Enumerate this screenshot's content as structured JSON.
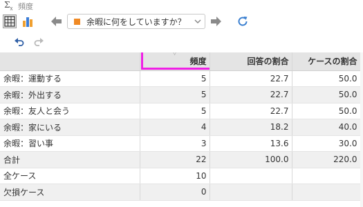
{
  "window": {
    "title": "頻度"
  },
  "toolbar": {
    "variable_select": "余暇に何をしていますか？",
    "accent_color": "#f08a24",
    "highlight_color": "#f01fe6"
  },
  "table": {
    "headers": [
      "",
      "頻度",
      "回答の割合",
      "ケースの割合"
    ],
    "rows": [
      {
        "label": "余暇：運動する",
        "freq": "5",
        "resp_pct": "22.7",
        "case_pct": "50.0"
      },
      {
        "label": "余暇：外出する",
        "freq": "5",
        "resp_pct": "22.7",
        "case_pct": "50.0"
      },
      {
        "label": "余暇：友人と会う",
        "freq": "5",
        "resp_pct": "22.7",
        "case_pct": "50.0"
      },
      {
        "label": "余暇：家にいる",
        "freq": "4",
        "resp_pct": "18.2",
        "case_pct": "40.0"
      },
      {
        "label": "余暇：習い事",
        "freq": "3",
        "resp_pct": "13.6",
        "case_pct": "30.0"
      },
      {
        "label": "合計",
        "freq": "22",
        "resp_pct": "100.0",
        "case_pct": "220.0"
      },
      {
        "label": "全ケース",
        "freq": "10",
        "resp_pct": "",
        "case_pct": ""
      },
      {
        "label": "欠損ケース",
        "freq": "0",
        "resp_pct": "",
        "case_pct": ""
      }
    ]
  }
}
